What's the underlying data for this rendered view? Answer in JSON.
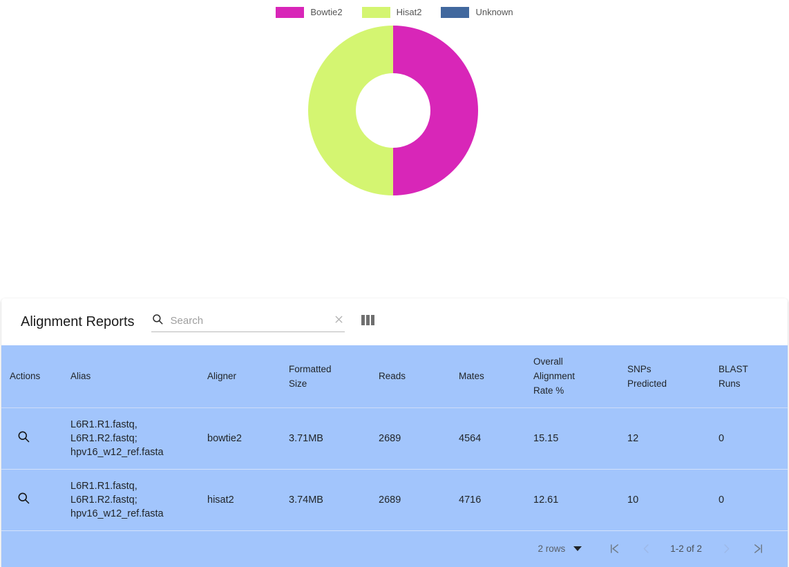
{
  "chart_data": {
    "type": "pie",
    "variant": "donut",
    "title": "",
    "legend_position": "top",
    "labels": [
      "Bowtie2",
      "Hisat2",
      "Unknown"
    ],
    "values": [
      1,
      1,
      0
    ],
    "percentages": [
      50,
      50,
      0
    ],
    "colors": [
      "#d826b8",
      "#d4f571",
      "#41689e"
    ],
    "inner_radius_ratio": 0.44,
    "start_angle_deg": 0,
    "notes": "Two equal halves: Bowtie2 right half, Hisat2 left half; Unknown has zero value and is not drawn."
  },
  "legend": {
    "items": [
      {
        "label": "Bowtie2",
        "color": "#d826b8"
      },
      {
        "label": "Hisat2",
        "color": "#d4f571"
      },
      {
        "label": "Unknown",
        "color": "#41689e"
      }
    ]
  },
  "toolbar": {
    "title": "Alignment Reports",
    "search_value": "",
    "search_placeholder": "Search",
    "search_icon": "search-icon",
    "clear_icon": "close-icon",
    "columns_icon": "view-column-icon"
  },
  "table": {
    "columns": [
      "Actions",
      "Alias",
      "Aligner",
      "Formatted\nSize",
      "Reads",
      "Mates",
      "Overall\nAlignment\nRate %",
      "SNPs\nPredicted",
      "BLAST\nRuns"
    ],
    "rows": [
      {
        "action_icon": "search-icon",
        "alias": "L6R1.R1.fastq,\nL6R1.R2.fastq;\nhpv16_w12_ref.fasta",
        "aligner": "bowtie2",
        "formatted_size": "3.71MB",
        "reads": "2689",
        "mates": "4564",
        "overall_alignment_rate": "15.15",
        "snps_predicted": "12",
        "blast_runs": "0"
      },
      {
        "action_icon": "search-icon",
        "alias": "L6R1.R1.fastq,\nL6R1.R2.fastq;\nhpv16_w12_ref.fasta",
        "aligner": "hisat2",
        "formatted_size": "3.74MB",
        "reads": "2689",
        "mates": "4716",
        "overall_alignment_rate": "12.61",
        "snps_predicted": "10",
        "blast_runs": "0"
      }
    ]
  },
  "pagination": {
    "rows_per_page_label": "2 rows",
    "page_info": "1-2 of 2",
    "first_page_icon": "first-page-icon",
    "previous_page_icon": "chevron-left-icon",
    "next_page_icon": "chevron-right-icon",
    "last_page_icon": "last-page-icon"
  },
  "colors": {
    "table_background": "#a2c5fc",
    "card_background": "#ffffff",
    "bowtie2": "#d826b8",
    "hisat2": "#d4f571",
    "unknown": "#41689e"
  }
}
